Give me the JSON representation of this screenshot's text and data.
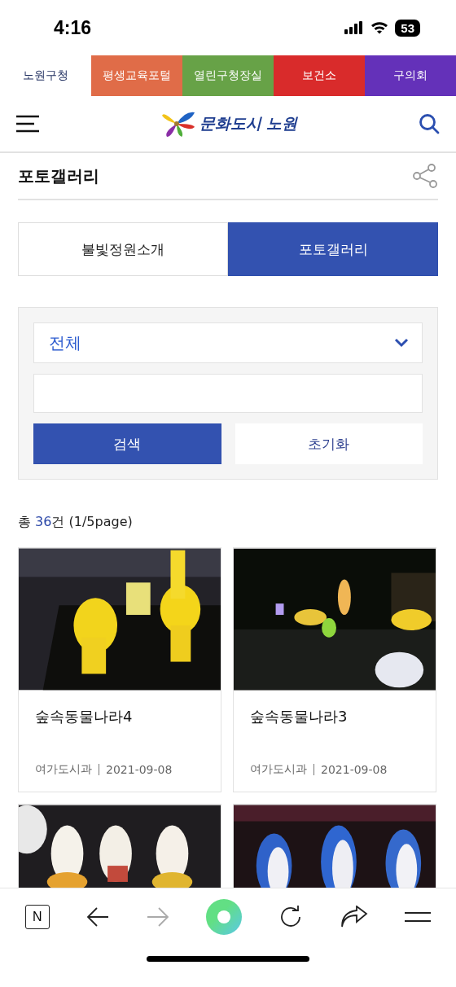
{
  "status_bar": {
    "time": "4:16",
    "battery": "53"
  },
  "site_tabs": [
    {
      "label": "노원구청",
      "color": "#ffffff",
      "selected": true
    },
    {
      "label": "평생교육포털",
      "color": "#e06c48",
      "selected": false
    },
    {
      "label": "열린구청장실",
      "color": "#67a247",
      "selected": false
    },
    {
      "label": "보건소",
      "color": "#d92b2b",
      "selected": false
    },
    {
      "label": "구의회",
      "color": "#6431b9",
      "selected": false
    }
  ],
  "header": {
    "logo_text": "문화도시 노원"
  },
  "page_title": "포토갤러리",
  "tabs": [
    {
      "label": "불빛정원소개",
      "selected": false
    },
    {
      "label": "포토갤러리",
      "selected": true
    }
  ],
  "search": {
    "category": "전체",
    "buttons": [
      {
        "label": "검색",
        "kind": "primary"
      },
      {
        "label": "초기화",
        "kind": "secondary"
      }
    ]
  },
  "count": {
    "prefix": "총 ",
    "number": "36",
    "suffix": "건 (1/5page)"
  },
  "gallery": [
    {
      "kind": "card",
      "title": "숲속동물나라4",
      "dept": "여가도시과",
      "date": "2021-09-08"
    },
    {
      "kind": "card",
      "title": "숲속동물나라3",
      "dept": "여가도시과",
      "date": "2021-09-08"
    },
    {
      "kind": "picture"
    },
    {
      "kind": "picture"
    }
  ],
  "browser_bar": {
    "tab_label": "N",
    "forward_disabled": true
  }
}
